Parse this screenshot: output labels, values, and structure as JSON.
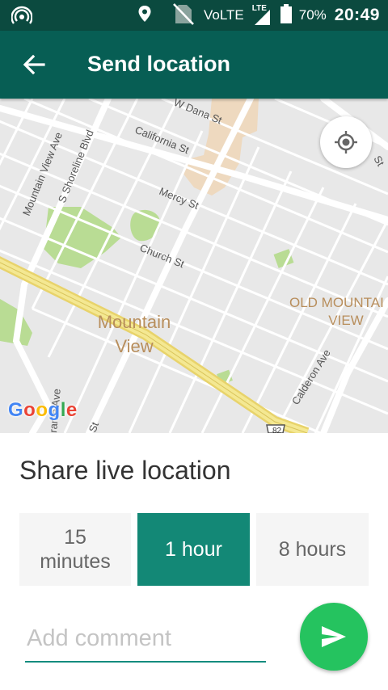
{
  "status_bar": {
    "network_label": "VoLTE",
    "lte_label": "LTE",
    "battery": "70%",
    "time": "20:49",
    "icons": [
      "hotspot-icon",
      "location-icon",
      "no-sim-icon",
      "signal-icon",
      "battery-icon"
    ]
  },
  "app_bar": {
    "title": "Send location",
    "back_icon": "arrow-back-icon"
  },
  "map": {
    "streets": [
      "W Dana St",
      "California St",
      "Mercy St",
      "Church St",
      "Mountain View Ave",
      "S Shoreline Blvd",
      "Calderon Ave",
      "rante Ave",
      "St",
      "St"
    ],
    "places": {
      "city_line1": "Mountain",
      "city_line2": "View",
      "district_line1": "OLD MOUNTAI",
      "district_line2": "VIEW"
    },
    "highway_shield": "82",
    "attribution": [
      "G",
      "o",
      "o",
      "g",
      "l",
      "e"
    ],
    "locate_icon": "my-location-icon"
  },
  "sheet": {
    "title": "Share live location",
    "durations": [
      {
        "line1": "15",
        "line2": "minutes",
        "selected": false
      },
      {
        "line1": "1 hour",
        "selected": true
      },
      {
        "line1": "8 hours",
        "selected": false
      }
    ],
    "comment_placeholder": "Add comment",
    "comment_value": "",
    "send_icon": "send-icon"
  },
  "colors": {
    "status_bar": "#0b4a3f",
    "app_bar": "#075e54",
    "accent": "#128c7e",
    "selected_chip": "#138876",
    "send_button": "#25c35f"
  }
}
